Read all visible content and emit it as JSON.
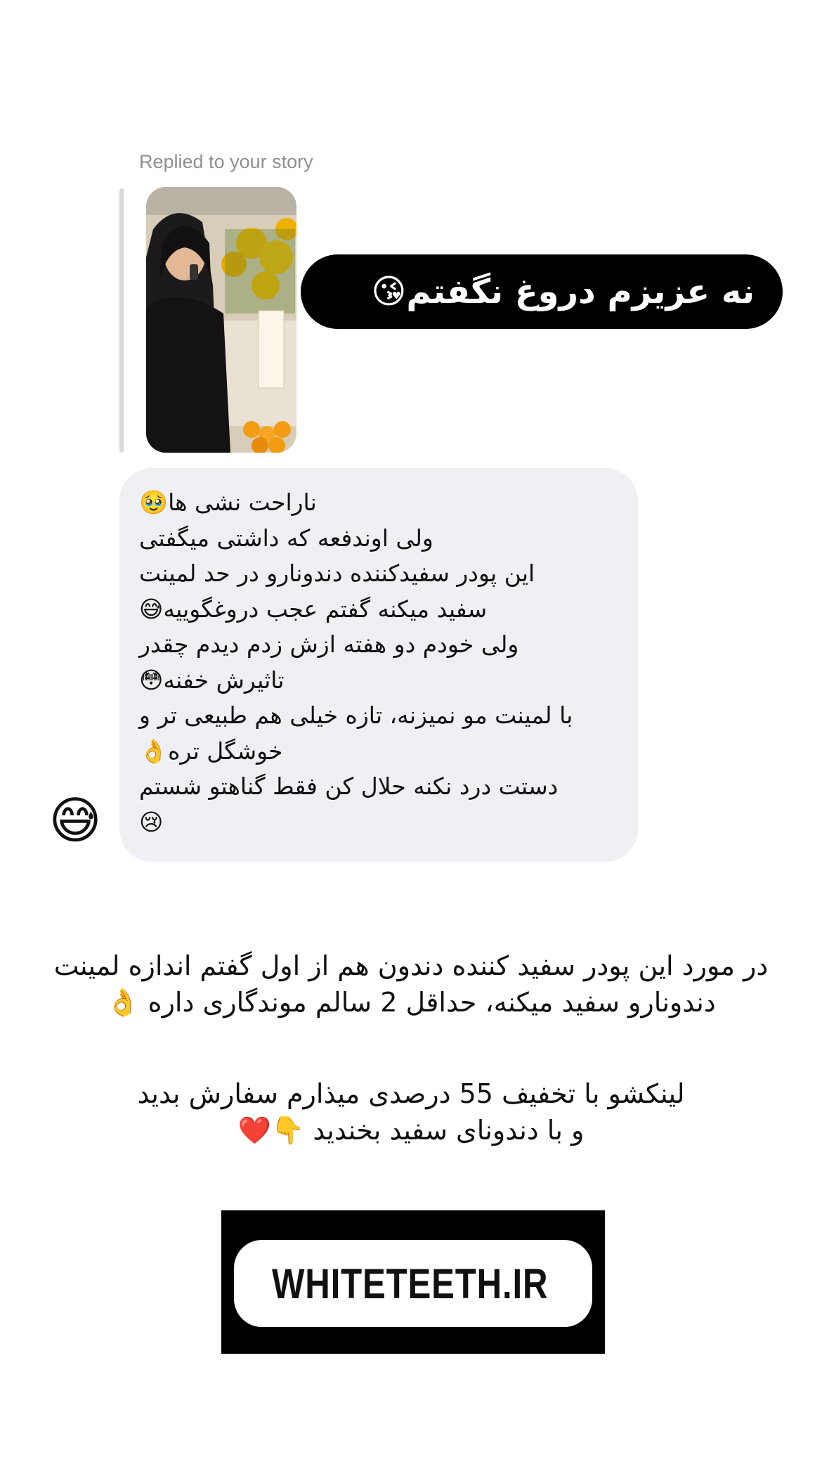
{
  "header": {
    "replied_label": "Replied to your story"
  },
  "story_reply": {
    "text": "نه عزیزم دروغ نگفتم😘"
  },
  "message": {
    "lines": [
      "ناراحت نشی ها🥹",
      "ولی اوندفعه که داشتی میگفتی",
      "این پودر سفیدکننده دندونارو در حد لمینت",
      "سفید میکنه گفتم عجب دروغگوییه😅",
      "ولی خودم دو هفته ازش زدم دیدم چقدر",
      "تاثیرش خفنه😳",
      "با لمینت مو نمیزنه، تازه خیلی هم طبیعی تر و",
      "خوشگل تره👌",
      "دستت درد نکنه حلال کن فقط گناهتو شستم",
      "😢"
    ],
    "reaction": "😅"
  },
  "caption": {
    "paragraph1": [
      "در مورد این پودر سفید کننده دندون هم از اول گفتم اندازه لمینت",
      "دندونارو سفید میکنه، حداقل 2 سالم موندگاری داره 👌"
    ],
    "paragraph2": [
      "لینکشو با تخفیف 55 درصدی میذارم سفارش بدید",
      "و با دندونای سفید بخندید 👇❤️"
    ]
  },
  "link_sticker": {
    "label": "WHITETEETH.IR",
    "icon": "link-icon"
  },
  "colors": {
    "bubble": "#eff0f3",
    "pill": "#000000",
    "link_gradient_start": "#f58529",
    "link_gradient_end": "#dd2a7b"
  }
}
